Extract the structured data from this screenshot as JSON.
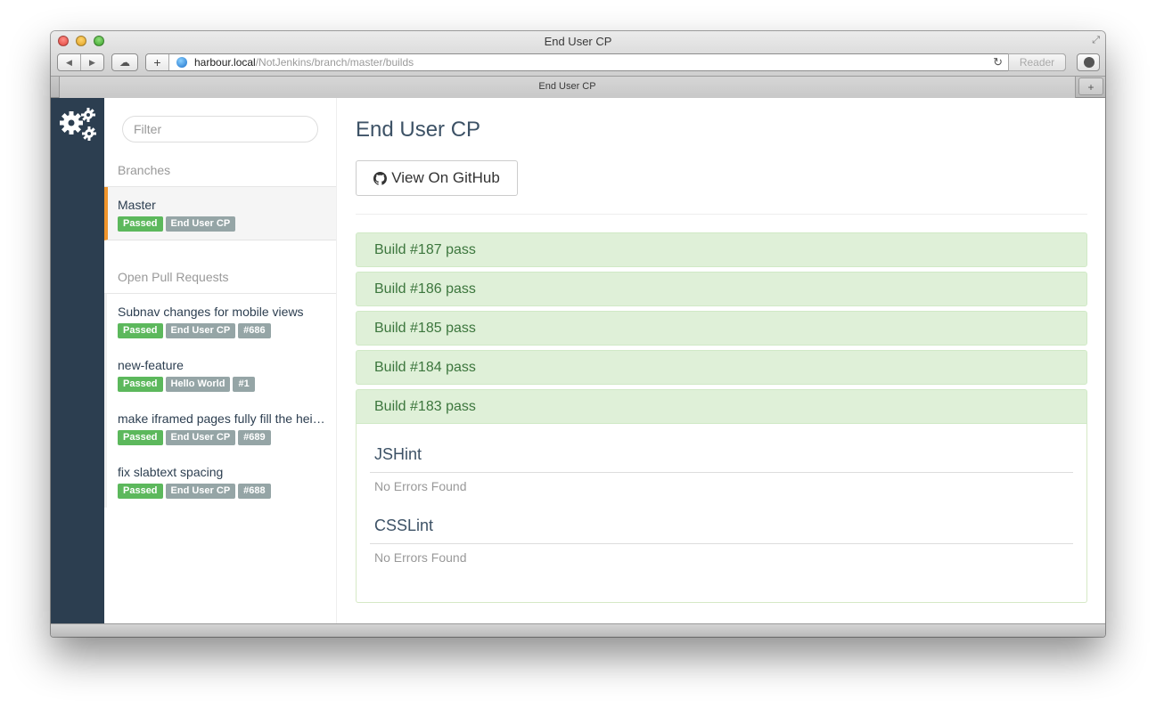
{
  "browser": {
    "window_title": "End User CP",
    "url_host": "harbour.local",
    "url_path": "/NotJenkins/branch/master/builds",
    "reader_label": "Reader",
    "tab_title": "End User CP",
    "back_glyph": "◀",
    "forward_glyph": "▶",
    "cloud_glyph": "☁",
    "add_glyph": "+",
    "reload_glyph": "↻",
    "newtab_glyph": "+",
    "fullscreen_glyph": "⤢"
  },
  "sidebar": {
    "filter_placeholder": "Filter",
    "branches_heading": "Branches",
    "branches": [
      {
        "title": "Master",
        "status": "Passed",
        "project": "End User CP"
      }
    ],
    "prs_heading": "Open Pull Requests",
    "pull_requests": [
      {
        "title": "Subnav changes for mobile views",
        "status": "Passed",
        "project": "End User CP",
        "number": "#686"
      },
      {
        "title": "new-feature",
        "status": "Passed",
        "project": "Hello World",
        "number": "#1"
      },
      {
        "title": "make iframed pages fully fill the height",
        "status": "Passed",
        "project": "End User CP",
        "number": "#689"
      },
      {
        "title": "fix slabtext spacing",
        "status": "Passed",
        "project": "End User CP",
        "number": "#688"
      }
    ]
  },
  "main": {
    "title": "End User CP",
    "github_button": "View On GitHub",
    "builds": [
      {
        "label": "Build #187 pass"
      },
      {
        "label": "Build #186 pass"
      },
      {
        "label": "Build #185 pass"
      },
      {
        "label": "Build #184 pass"
      },
      {
        "label": "Build #183 pass"
      }
    ],
    "expanded_build": {
      "checks": [
        {
          "name": "JSHint",
          "status": "No Errors Found"
        },
        {
          "name": "CSSLint",
          "status": "No Errors Found"
        }
      ]
    }
  },
  "colors": {
    "sidebar_dark": "#2c3e50",
    "active_accent": "#f0952c",
    "passed_badge": "#5cb85c",
    "build_pass_bg": "#dff0d8",
    "build_pass_text": "#3c763d"
  }
}
